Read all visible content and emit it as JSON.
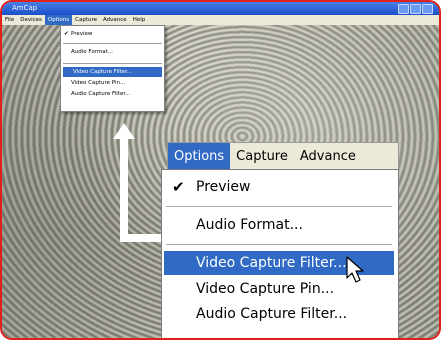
{
  "window": {
    "title": "AmCap"
  },
  "menubar": [
    "File",
    "Devices",
    "Options",
    "Capture",
    "Advance",
    "Help"
  ],
  "small_menu": {
    "items": [
      {
        "label": "Preview",
        "checked": true,
        "highlighted": false
      },
      {
        "label": "Audio Format...",
        "checked": false,
        "highlighted": false
      },
      {
        "label": "Video Capture Filter...",
        "checked": false,
        "highlighted": true
      },
      {
        "label": "Video Capture Pin...",
        "checked": false,
        "highlighted": false
      },
      {
        "label": "Audio Capture Filter...",
        "checked": false,
        "highlighted": false
      }
    ]
  },
  "zoom": {
    "menubar": [
      "Options",
      "Capture",
      "Advance"
    ],
    "items": [
      {
        "label": "Preview",
        "checked": true,
        "highlighted": false
      },
      {
        "label": "Audio Format...",
        "checked": false,
        "highlighted": false
      },
      {
        "label": "Video Capture Filter...",
        "checked": false,
        "highlighted": true
      },
      {
        "label": "Video Capture Pin...",
        "checked": false,
        "highlighted": false
      },
      {
        "label": "Audio Capture Filter...",
        "checked": false,
        "highlighted": false
      }
    ]
  },
  "icons": {
    "check": "check-icon",
    "cursor": "mouse-pointer-icon"
  },
  "colors": {
    "frame": "#e0201b",
    "highlight": "#316ac5",
    "titlebar": "#1a4fc8"
  }
}
